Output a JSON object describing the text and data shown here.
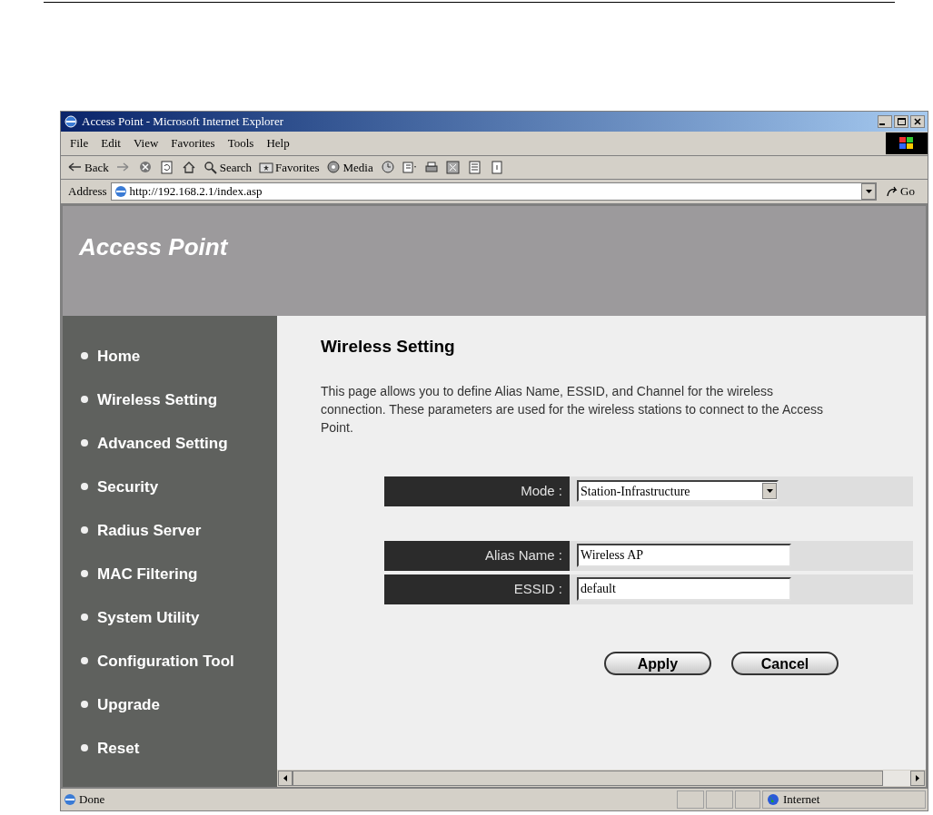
{
  "window": {
    "title": "Access Point - Microsoft Internet Explorer"
  },
  "menu": [
    "File",
    "Edit",
    "View",
    "Favorites",
    "Tools",
    "Help"
  ],
  "toolbar": [
    {
      "kind": "back",
      "label": "Back"
    },
    {
      "kind": "forward"
    },
    {
      "kind": "stop"
    },
    {
      "kind": "refresh"
    },
    {
      "kind": "home"
    },
    {
      "kind": "search",
      "label": "Search"
    },
    {
      "kind": "favorites",
      "label": "Favorites"
    },
    {
      "kind": "media",
      "label": "Media"
    },
    {
      "kind": "history"
    },
    {
      "kind": "mail"
    },
    {
      "kind": "print"
    },
    {
      "kind": "edit"
    },
    {
      "kind": "discuss"
    },
    {
      "kind": "messenger"
    }
  ],
  "address": {
    "label": "Address",
    "url": "http://192.168.2.1/index.asp",
    "go": "Go"
  },
  "header": {
    "title": "Access Point"
  },
  "sidebar": {
    "items": [
      "Home",
      "Wireless Setting",
      "Advanced Setting",
      "Security",
      "Radius Server",
      "MAC Filtering",
      "System Utility",
      "Configuration Tool",
      "Upgrade",
      "Reset"
    ]
  },
  "content": {
    "title": "Wireless Setting",
    "description": "This page allows you to define Alias Name, ESSID, and Channel for the wireless connection. These parameters are used for the wireless stations to connect to the Access Point.",
    "fields": [
      {
        "kind": "select",
        "label": "Mode :",
        "value": "Station-Infrastructure"
      },
      {
        "kind": "text",
        "label": "Alias Name :",
        "value": "Wireless AP"
      },
      {
        "kind": "text",
        "label": "ESSID :",
        "value": "default"
      }
    ],
    "buttons": [
      "Apply",
      "Cancel"
    ]
  },
  "status_bar": {
    "text": "Done",
    "zone": "Internet"
  }
}
